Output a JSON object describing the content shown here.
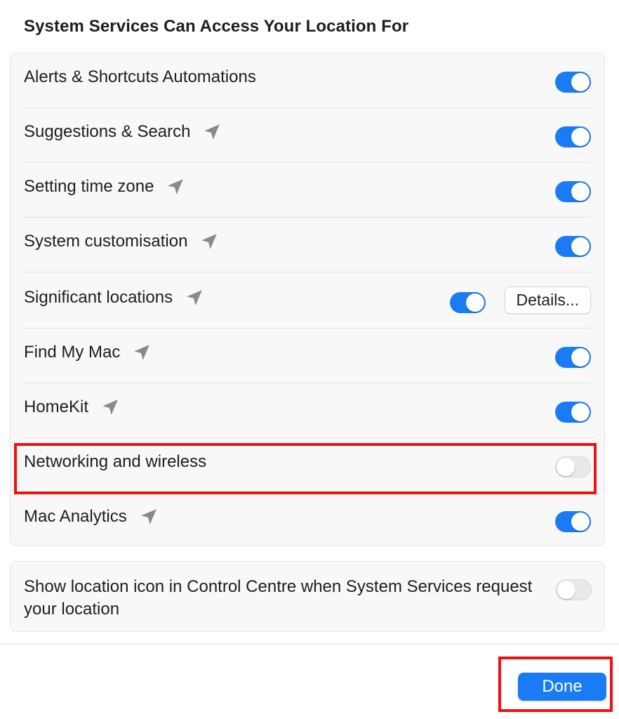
{
  "header": {
    "title": "System Services Can Access Your Location For"
  },
  "services": [
    {
      "label": "Alerts & Shortcuts Automations",
      "enabled": true,
      "show_arrow": false
    },
    {
      "label": "Suggestions & Search",
      "enabled": true,
      "show_arrow": true
    },
    {
      "label": "Setting time zone",
      "enabled": true,
      "show_arrow": true
    },
    {
      "label": "System customisation",
      "enabled": true,
      "show_arrow": true
    },
    {
      "label": "Significant locations",
      "enabled": true,
      "show_arrow": true,
      "details_label": "Details..."
    },
    {
      "label": "Find My Mac",
      "enabled": true,
      "show_arrow": true
    },
    {
      "label": "HomeKit",
      "enabled": true,
      "show_arrow": true
    },
    {
      "label": "Networking and wireless",
      "enabled": false,
      "show_arrow": false
    },
    {
      "label": "Mac Analytics",
      "enabled": true,
      "show_arrow": true
    }
  ],
  "show_icon": {
    "label": "Show location icon in Control Centre when System Services request your location",
    "enabled": false
  },
  "footer": {
    "done_label": "Done"
  },
  "icons": {
    "location_arrow": "location-arrow-icon"
  },
  "colors": {
    "accent": "#1a7cf5",
    "toggle_off": "#e9e9eb",
    "highlight": "#ee1111",
    "arrow": "#8a8a8a"
  }
}
